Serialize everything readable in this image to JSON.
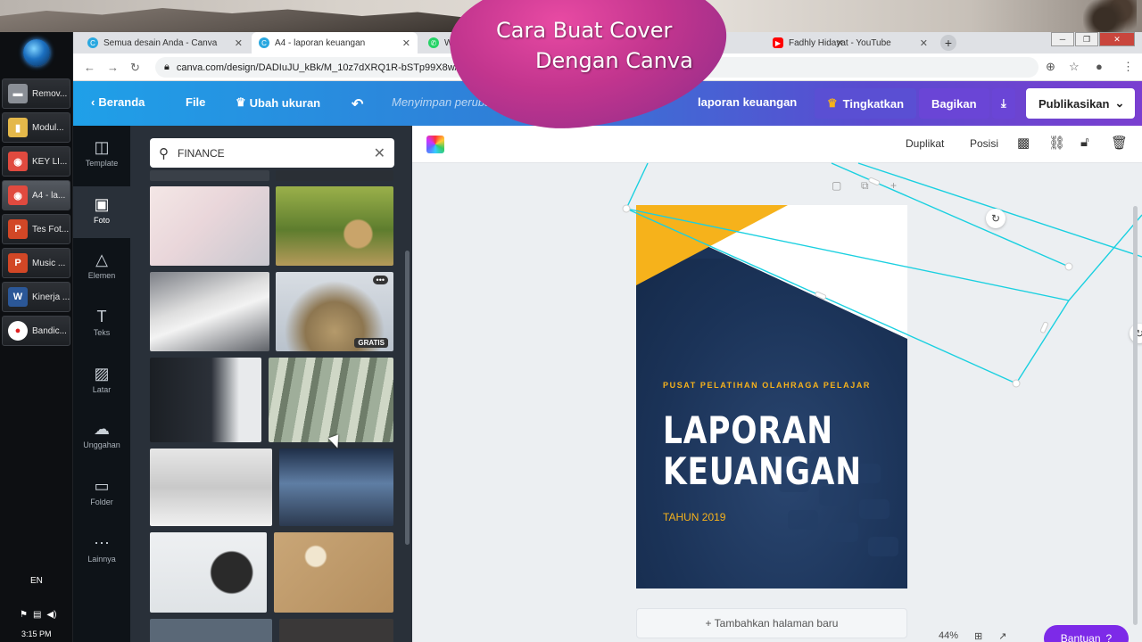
{
  "taskbar": {
    "items": [
      {
        "label": "Remov...",
        "icon": "drive-icon",
        "color": "#8a8f96"
      },
      {
        "label": "Modul...",
        "icon": "folder-icon",
        "color": "#e4b84a"
      },
      {
        "label": "KEY LI...",
        "icon": "chrome-icon",
        "color": "#e04a3f"
      },
      {
        "label": "A4 - la...",
        "icon": "chrome-icon",
        "color": "#e04a3f"
      },
      {
        "label": "Tes Fot...",
        "icon": "powerpoint-icon",
        "color": "#d24726"
      },
      {
        "label": "Music ...",
        "icon": "powerpoint-icon",
        "color": "#d24726"
      },
      {
        "label": "Kinerja ...",
        "icon": "word-icon",
        "color": "#2b5797"
      },
      {
        "label": "Bandic...",
        "icon": "record-icon",
        "color": "#e02020"
      }
    ],
    "lang": "EN",
    "time": "3:15 PM"
  },
  "browser": {
    "tabs": [
      {
        "label": "Semua desain Anda - Canva",
        "icon": "canva-icon",
        "color": "#2aa8e0"
      },
      {
        "label": "A4 - laporan keuangan",
        "icon": "canva-icon",
        "color": "#2aa8e0"
      },
      {
        "label": "W",
        "icon": "whatsapp-icon",
        "color": "#25d366"
      },
      {
        "label": "Fadhly Hidayat - YouTube",
        "icon": "youtube-icon",
        "color": "#ff0000"
      }
    ],
    "url": "canva.com/design/DADIuJU_kBk/M_10z7dXRQ1R-bSTp99X8w/ed"
  },
  "overlay": {
    "line1": "Cara Buat Cover",
    "line2": "Dengan Canva"
  },
  "canva": {
    "home": "Beranda",
    "file": "File",
    "resize": "Ubah ukuran",
    "saving": "Menyimpan perubahan",
    "doc_title": "laporan keuangan",
    "upgrade": "Tingkatkan",
    "share": "Bagikan",
    "publish": "Publikasikan",
    "sidebar": [
      {
        "label": "Template",
        "icon": "template-icon"
      },
      {
        "label": "Foto",
        "icon": "photo-icon"
      },
      {
        "label": "Elemen",
        "icon": "elements-icon"
      },
      {
        "label": "Teks",
        "icon": "text-icon"
      },
      {
        "label": "Latar",
        "icon": "background-icon"
      },
      {
        "label": "Unggahan",
        "icon": "upload-icon"
      },
      {
        "label": "Folder",
        "icon": "folder-icon"
      },
      {
        "label": "Lainnya",
        "icon": "more-icon"
      }
    ],
    "search_value": "FINANCE",
    "free_badge": "GRATIS",
    "toolbar": {
      "duplicate": "Duplikat",
      "position": "Posisi"
    },
    "page": {
      "org": "PUSAT PELATIHAN OLAHRAGA PELAJAR",
      "title1": "LAPORAN",
      "title2": "KEUANGAN",
      "year": "TAHUN 2019",
      "accent": "#f6b21b",
      "bg": "#1b3358"
    },
    "add_page": "+ Tambahkan halaman baru",
    "zoom": "44%",
    "help": "Bantuan"
  }
}
